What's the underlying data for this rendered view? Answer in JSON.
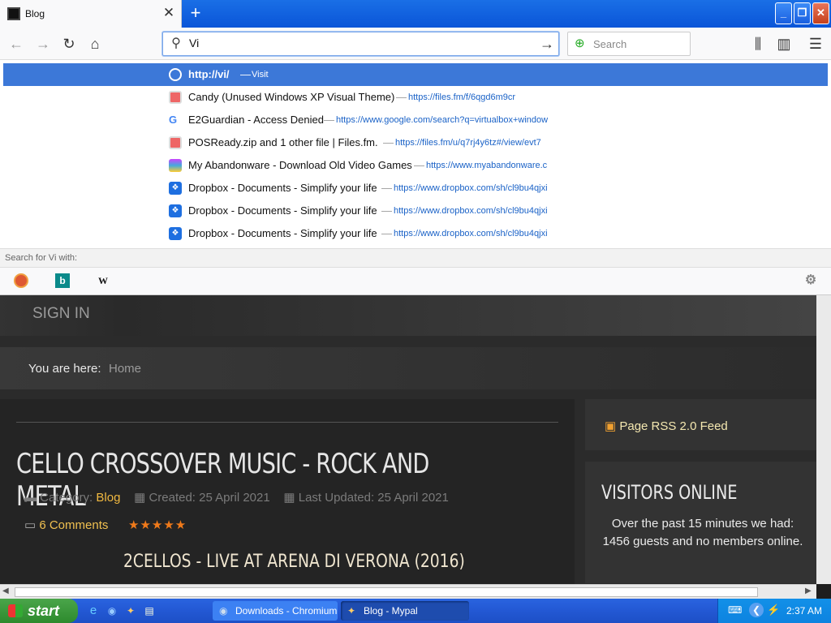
{
  "browser": {
    "tab_title": "Blog",
    "url_text": "Vi",
    "search_placeholder": "Search"
  },
  "dropdown": {
    "items": [
      {
        "title": "http://vi/",
        "dash": "—",
        "url": "Visit"
      },
      {
        "title": "Candy (Unused Windows XP Visual Theme)",
        "dash": "—",
        "url": "https://files.fm/f/6qgd6m9cr"
      },
      {
        "title": "E2Guardian - Access Denied",
        "dash": "—",
        "url": "https://www.google.com/search?q=virtualbox+window"
      },
      {
        "title": "POSReady.zip and 1 other file | Files.fm.",
        "dash": "—",
        "url": "https://files.fm/u/q7rj4y6tz#/view/evt7"
      },
      {
        "title": "My Abandonware - Download Old Video Games",
        "dash": "—",
        "url": "https://www.myabandonware.c"
      },
      {
        "title": "Dropbox - Documents - Simplify your life",
        "dash": "—",
        "url": "https://www.dropbox.com/sh/cl9bu4qjxi"
      },
      {
        "title": "Dropbox - Documents - Simplify your life",
        "dash": "—",
        "url": "https://www.dropbox.com/sh/cl9bu4qjxi"
      },
      {
        "title": "Dropbox - Documents - Simplify your life",
        "dash": "—",
        "url": "https://www.dropbox.com/sh/cl9bu4qjxi"
      }
    ],
    "search_with": "Search for Vi with:",
    "engines": [
      "DuckDuckGo",
      "Bing",
      "W"
    ]
  },
  "page": {
    "sign_in": "SIGN IN",
    "breadcrumb_label": "You are here:",
    "breadcrumb_home": "Home",
    "article_title": "CELLO CROSSOVER MUSIC - ROCK AND METAL",
    "category_label": "Category:",
    "category": "Blog",
    "created": "Created: 25 April 2021",
    "updated": "Last Updated: 25 April 2021",
    "comments": "6 Comments",
    "stars": "★★★★★",
    "subtitle": "2CELLOS - LIVE AT ARENA DI VERONA (2016)",
    "rss": "Page RSS 2.0 Feed",
    "visitors_title": "VISITORS ONLINE",
    "visitors_text": "Over the past 15 minutes we had: 1456 guests and no members online."
  },
  "taskbar": {
    "start": "start",
    "task1": "Downloads - Chromium",
    "task2": "Blog - Mypal",
    "clock": "2:37 AM"
  },
  "colors": {
    "accent": "#3c78d8",
    "link_gold": "#f0b840",
    "taskbar_blue": "#245ad6"
  }
}
